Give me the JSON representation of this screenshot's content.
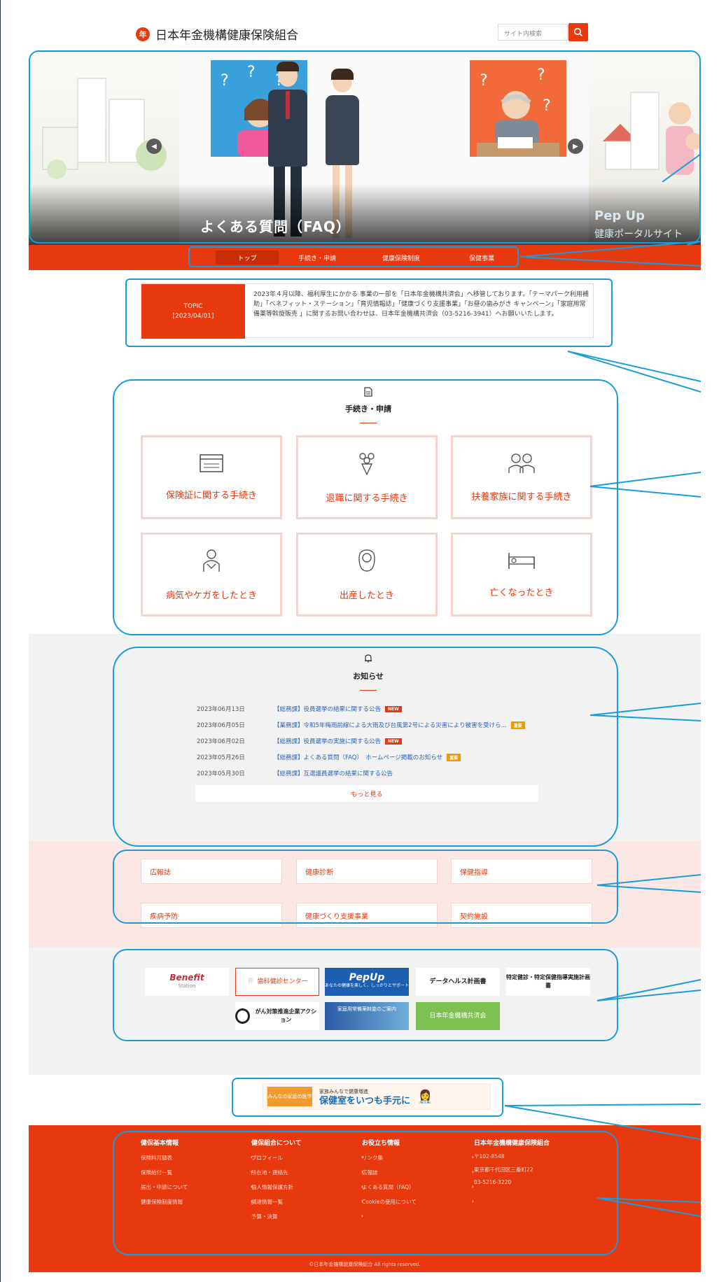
{
  "header": {
    "logo_mark": "年",
    "site_name": "日本年金機構健康保険組合",
    "search_placeholder": "サイト内検索"
  },
  "hero": {
    "title": "よくある質問（FAQ）",
    "side_title": "Pep Up",
    "side_subtitle": "健康ポータルサイト"
  },
  "nav": {
    "items": [
      "トップ",
      "手続き・申請",
      "健康保険制度",
      "保健事業"
    ],
    "active_index": 0
  },
  "topic": {
    "label": "TOPIC",
    "date": "[2023/04/01]",
    "text": "2023年４月以降、福利厚生にかかる 事業の一部を「日本年金機構共済会」へ移管しております。「テーマパーク利用補助」「ベネフィット・ステーション」「育児情報誌」「健康づくり支援事業」「お昼の歯みがき キャンペーン」「家庭用常備薬等斡旋販売 」に関するお問い合わせは、日本年金機構共済会（03-5216-3941）へお願いいたします。"
  },
  "procedures": {
    "title": "手続き・申請",
    "cards": [
      {
        "label": "保険証に関する手続き",
        "icon": "card-icon"
      },
      {
        "label": "退職に関する手続き",
        "icon": "bouquet-icon"
      },
      {
        "label": "扶養家族に関する手続き",
        "icon": "family-icon"
      },
      {
        "label": "病気やケガをしたとき",
        "icon": "injury-icon"
      },
      {
        "label": "出産したとき",
        "icon": "baby-icon"
      },
      {
        "label": "亡くなったとき",
        "icon": "bed-icon"
      }
    ]
  },
  "news": {
    "title": "お知らせ",
    "items": [
      {
        "date": "2023年06月13日",
        "title": "【総務課】役員選挙の結果に関する公告",
        "badge": "NEW"
      },
      {
        "date": "2023年06月05日",
        "title": "【業務課】令和5年梅雨前線による大雨及び台風第2号による災害により被害を受けら...",
        "badge": "重要"
      },
      {
        "date": "2023年06月02日",
        "title": "【総務課】役員選挙の実施に関する公告",
        "badge": "NEW"
      },
      {
        "date": "2023年05月26日",
        "title": "【総務課】よくある質問（FAQ）　ホームページ掲載のお知らせ",
        "badge": "重要"
      },
      {
        "date": "2023年05月30日",
        "title": "【総務課】互選議員選挙の結果に関する公告",
        "badge": ""
      }
    ],
    "more_label": "もっと見る"
  },
  "health_links": [
    "広報誌",
    "健康診断",
    "保健指導",
    "疾病予防",
    "健康づくり支援事業",
    "契約施設"
  ],
  "banners": {
    "benefit": "Benefit",
    "benefit_sub": "Station",
    "dental": "歯科健診センター",
    "pepup": "PepUp",
    "pepup_sub": "あなたの健康を楽しく、しっかりとサポート",
    "datahealth": "データヘルス計画書",
    "tokutei": "特定健診・特定保健指導実施計画書",
    "cancer": "がん対策推進企業アクション",
    "medicine": "家庭用常備薬斡旋のご案内",
    "kyosaikai": "日本年金機構共済会"
  },
  "family_banner": {
    "tag": "みんなの家庭の医学",
    "lead": "家族みんなで健康増進",
    "main": "保健室をいつも手元に"
  },
  "footer": {
    "columns": [
      {
        "title": "健保基本情報",
        "items": [
          "保険料月額表",
          "保険給付一覧",
          "届出・申請について",
          "健康保険制度情報"
        ]
      },
      {
        "title": "健保組合について",
        "items": [
          "プロフィール",
          "所在地・連絡先",
          "個人情報保護方針",
          "調達情報一覧",
          "予算・決算"
        ]
      },
      {
        "title": "お役立ち情報",
        "items": [
          "リンク集",
          "広報誌",
          "よくある質問（FAQ）",
          "Cookieの使用について"
        ]
      }
    ],
    "org_name": "日本年金機構健康保険組合",
    "postal": "〒102-8548",
    "address": "東京都千代田区三番町22",
    "phone": "03-5216-3220",
    "copyright": "©日本年金機構健康保険組合 All rights reserved."
  },
  "colors": {
    "brand": "#e8380d",
    "annotation": "#1a9cd8"
  }
}
